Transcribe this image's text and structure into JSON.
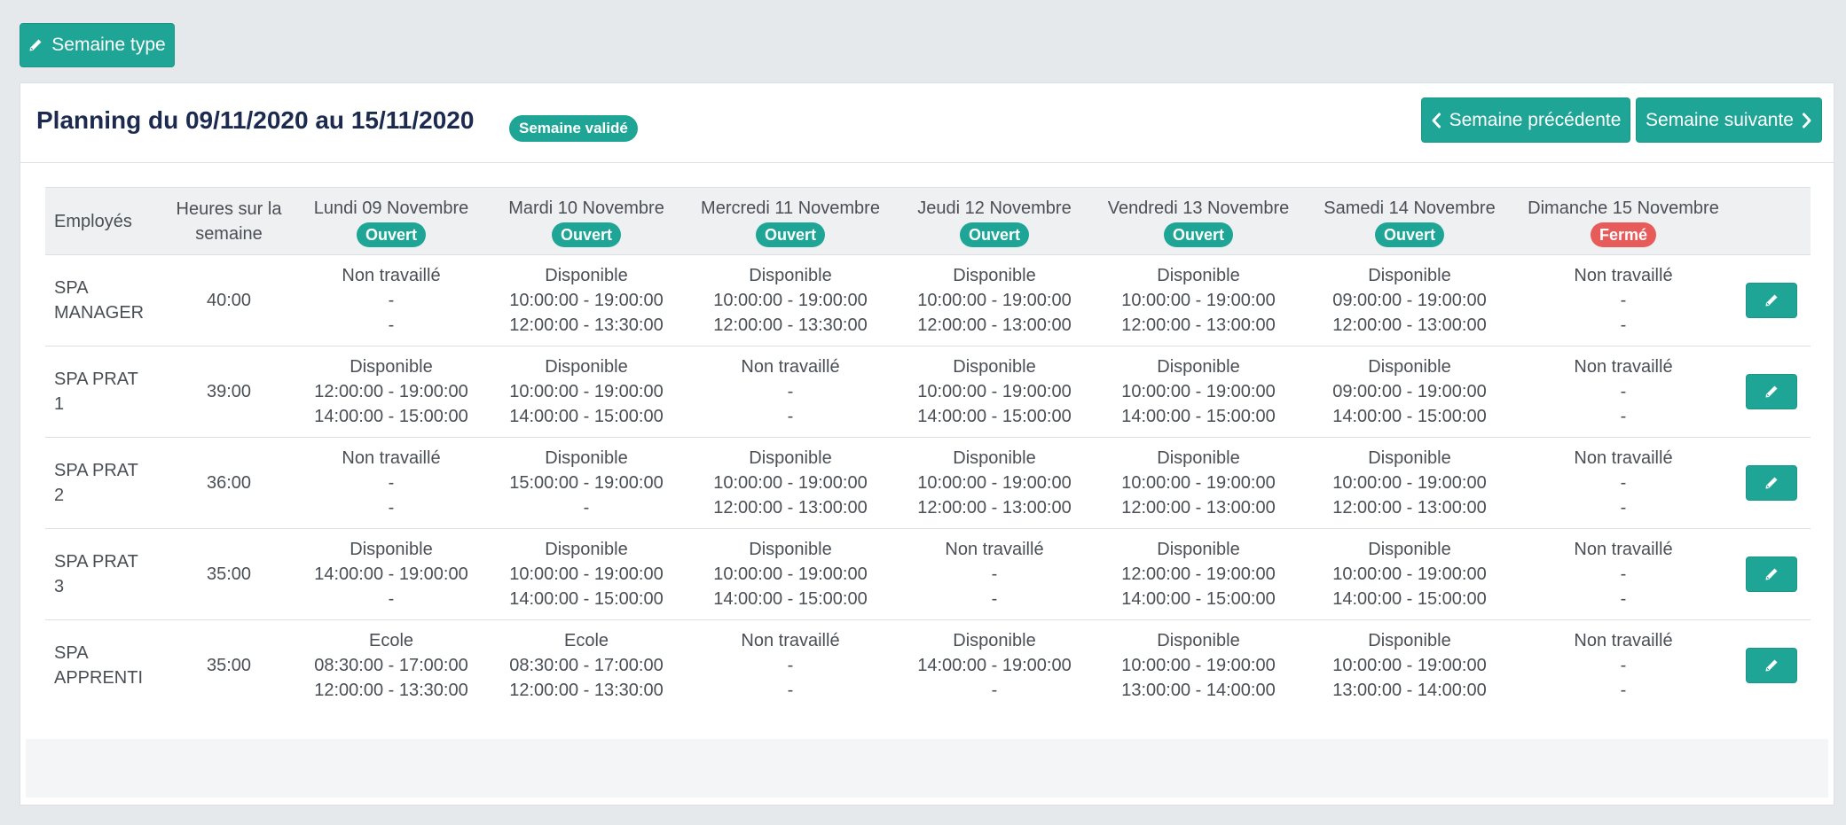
{
  "toolbar": {
    "semaine_type_label": "Semaine type"
  },
  "header": {
    "title": "Planning du 09/11/2020 au 15/11/2020",
    "status_badge": "Semaine validé",
    "prev_label": "Semaine précédente",
    "next_label": "Semaine suivante"
  },
  "colors": {
    "accent": "#1fa596",
    "closed": "#e85b5b",
    "title": "#1b2a4e"
  },
  "table": {
    "col_employees": "Employés",
    "col_hours_line1": "Heures sur la",
    "col_hours_line2": "semaine",
    "days": [
      {
        "label": "Lundi 09 Novembre",
        "status": "Ouvert",
        "status_color": "#1fa596"
      },
      {
        "label": "Mardi 10 Novembre",
        "status": "Ouvert",
        "status_color": "#1fa596"
      },
      {
        "label": "Mercredi 11 Novembre",
        "status": "Ouvert",
        "status_color": "#1fa596"
      },
      {
        "label": "Jeudi 12 Novembre",
        "status": "Ouvert",
        "status_color": "#1fa596"
      },
      {
        "label": "Vendredi 13 Novembre",
        "status": "Ouvert",
        "status_color": "#1fa596"
      },
      {
        "label": "Samedi 14 Novembre",
        "status": "Ouvert",
        "status_color": "#1fa596"
      },
      {
        "label": "Dimanche 15 Novembre",
        "status": "Fermé",
        "status_color": "#e85b5b"
      }
    ],
    "rows": [
      {
        "name_line1": "SPA",
        "name_line2": "MANAGER",
        "hours": "40:00",
        "days": [
          [
            "Non travaillé",
            "-",
            "-"
          ],
          [
            "Disponible",
            "10:00:00 - 19:00:00",
            "12:00:00 - 13:30:00"
          ],
          [
            "Disponible",
            "10:00:00 - 19:00:00",
            "12:00:00 - 13:30:00"
          ],
          [
            "Disponible",
            "10:00:00 - 19:00:00",
            "12:00:00 - 13:00:00"
          ],
          [
            "Disponible",
            "10:00:00 - 19:00:00",
            "12:00:00 - 13:00:00"
          ],
          [
            "Disponible",
            "09:00:00 - 19:00:00",
            "12:00:00 - 13:00:00"
          ],
          [
            "Non travaillé",
            "-",
            "-"
          ]
        ]
      },
      {
        "name_line1": "SPA PRAT",
        "name_line2": "1",
        "hours": "39:00",
        "days": [
          [
            "Disponible",
            "12:00:00 - 19:00:00",
            "14:00:00 - 15:00:00"
          ],
          [
            "Disponible",
            "10:00:00 - 19:00:00",
            "14:00:00 - 15:00:00"
          ],
          [
            "Non travaillé",
            "-",
            "-"
          ],
          [
            "Disponible",
            "10:00:00 - 19:00:00",
            "14:00:00 - 15:00:00"
          ],
          [
            "Disponible",
            "10:00:00 - 19:00:00",
            "14:00:00 - 15:00:00"
          ],
          [
            "Disponible",
            "09:00:00 - 19:00:00",
            "14:00:00 - 15:00:00"
          ],
          [
            "Non travaillé",
            "-",
            "-"
          ]
        ]
      },
      {
        "name_line1": "SPA PRAT",
        "name_line2": "2",
        "hours": "36:00",
        "days": [
          [
            "Non travaillé",
            "-",
            "-"
          ],
          [
            "Disponible",
            "15:00:00 - 19:00:00",
            "-"
          ],
          [
            "Disponible",
            "10:00:00 - 19:00:00",
            "12:00:00 - 13:00:00"
          ],
          [
            "Disponible",
            "10:00:00 - 19:00:00",
            "12:00:00 - 13:00:00"
          ],
          [
            "Disponible",
            "10:00:00 - 19:00:00",
            "12:00:00 - 13:00:00"
          ],
          [
            "Disponible",
            "10:00:00 - 19:00:00",
            "12:00:00 - 13:00:00"
          ],
          [
            "Non travaillé",
            "-",
            "-"
          ]
        ]
      },
      {
        "name_line1": "SPA PRAT",
        "name_line2": "3",
        "hours": "35:00",
        "days": [
          [
            "Disponible",
            "14:00:00 - 19:00:00",
            "-"
          ],
          [
            "Disponible",
            "10:00:00 - 19:00:00",
            "14:00:00 - 15:00:00"
          ],
          [
            "Disponible",
            "10:00:00 - 19:00:00",
            "14:00:00 - 15:00:00"
          ],
          [
            "Non travaillé",
            "-",
            "-"
          ],
          [
            "Disponible",
            "12:00:00 - 19:00:00",
            "14:00:00 - 15:00:00"
          ],
          [
            "Disponible",
            "10:00:00 - 19:00:00",
            "14:00:00 - 15:00:00"
          ],
          [
            "Non travaillé",
            "-",
            "-"
          ]
        ]
      },
      {
        "name_line1": "SPA",
        "name_line2": "APPRENTI",
        "hours": "35:00",
        "days": [
          [
            "Ecole",
            "08:30:00 - 17:00:00",
            "12:00:00 - 13:30:00"
          ],
          [
            "Ecole",
            "08:30:00 - 17:00:00",
            "12:00:00 - 13:30:00"
          ],
          [
            "Non travaillé",
            "-",
            "-"
          ],
          [
            "Disponible",
            "14:00:00 - 19:00:00",
            "-"
          ],
          [
            "Disponible",
            "10:00:00 - 19:00:00",
            "13:00:00 - 14:00:00"
          ],
          [
            "Disponible",
            "10:00:00 - 19:00:00",
            "13:00:00 - 14:00:00"
          ],
          [
            "Non travaillé",
            "-",
            "-"
          ]
        ]
      }
    ]
  }
}
